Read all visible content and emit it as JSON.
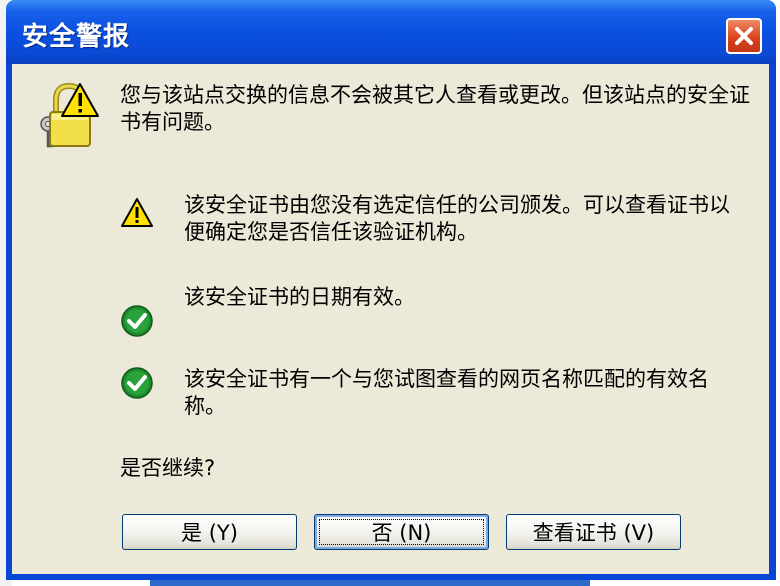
{
  "window": {
    "title": "安全警报"
  },
  "message": {
    "main": "您与该站点交换的信息不会被其它人查看或更改。但该站点的安全证书有问题。"
  },
  "conditions": [
    {
      "status": "warning",
      "icon": "warning-icon",
      "text": "该安全证书由您没有选定信任的公司颁发。可以查看证书以便确定您是否信任该验证机构。"
    },
    {
      "status": "ok",
      "icon": "check-icon",
      "text": "该安全证书的日期有效。"
    },
    {
      "status": "ok",
      "icon": "check-icon",
      "text": "该安全证书有一个与您试图查看的网页名称匹配的有效名称。"
    }
  ],
  "question": "是否继续?",
  "buttons": {
    "yes": "是 (Y)",
    "no": "否 (N)",
    "view_cert": "查看证书 (V)"
  },
  "icons": {
    "main": "lock-warning-icon",
    "close": "close-icon"
  },
  "colors": {
    "titlebar": "#0a4fe0",
    "client": "#ece9d8",
    "close_button": "#d9431e",
    "warning": "#ffe000",
    "ok": "#1e8a2e"
  }
}
